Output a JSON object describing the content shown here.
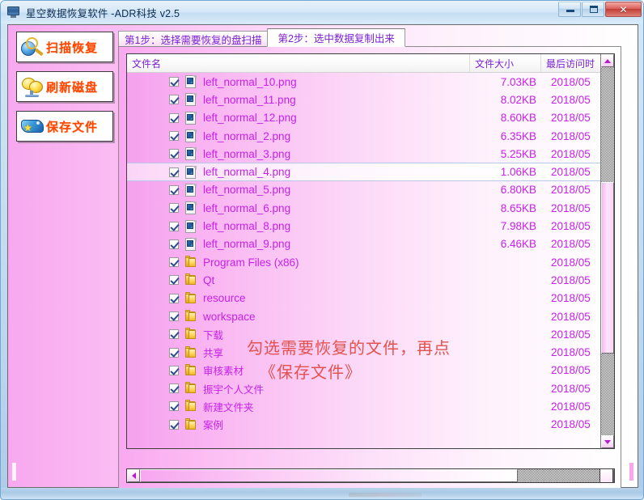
{
  "window": {
    "title": "星空数据恢复软件  -ADR科技 v2.5",
    "icon": "monitor-icon",
    "controls": {
      "minimize": "minimize-icon",
      "maximize": "maximize-icon",
      "close": "✕"
    }
  },
  "sidebar": {
    "buttons": [
      {
        "label": "扫描恢复",
        "icon": "magnifier-globe-icon"
      },
      {
        "label": "刷新磁盘",
        "icon": "refresh-disk-icon"
      },
      {
        "label": "保存文件",
        "icon": "save-file-icon"
      }
    ]
  },
  "tabs": [
    {
      "label": "第1步：选择需要恢复的盘扫描",
      "active": false
    },
    {
      "label": "第2步：选中数据复制出来",
      "active": true
    }
  ],
  "list": {
    "columns": [
      {
        "key": "name",
        "label": "文件名"
      },
      {
        "key": "size",
        "label": "文件大小"
      },
      {
        "key": "date",
        "label": "最后访问时"
      }
    ],
    "rows": [
      {
        "checked": true,
        "type": "file",
        "name": "left_normal_10.png",
        "size": "7.03KB",
        "date": "2018/05",
        "selected": false
      },
      {
        "checked": true,
        "type": "file",
        "name": "left_normal_11.png",
        "size": "8.02KB",
        "date": "2018/05",
        "selected": false
      },
      {
        "checked": true,
        "type": "file",
        "name": "left_normal_12.png",
        "size": "8.60KB",
        "date": "2018/05",
        "selected": false
      },
      {
        "checked": true,
        "type": "file",
        "name": "left_normal_2.png",
        "size": "6.35KB",
        "date": "2018/05",
        "selected": false
      },
      {
        "checked": true,
        "type": "file",
        "name": "left_normal_3.png",
        "size": "5.25KB",
        "date": "2018/05",
        "selected": false
      },
      {
        "checked": true,
        "type": "file",
        "name": "left_normal_4.png",
        "size": "1.06KB",
        "date": "2018/05",
        "selected": true
      },
      {
        "checked": true,
        "type": "file",
        "name": "left_normal_5.png",
        "size": "6.80KB",
        "date": "2018/05",
        "selected": false
      },
      {
        "checked": true,
        "type": "file",
        "name": "left_normal_6.png",
        "size": "8.65KB",
        "date": "2018/05",
        "selected": false
      },
      {
        "checked": true,
        "type": "file",
        "name": "left_normal_8.png",
        "size": "7.98KB",
        "date": "2018/05",
        "selected": false
      },
      {
        "checked": true,
        "type": "file",
        "name": "left_normal_9.png",
        "size": "6.46KB",
        "date": "2018/05",
        "selected": false
      },
      {
        "checked": true,
        "type": "folder",
        "name": "Program Files (x86)",
        "size": "",
        "date": "2018/05",
        "selected": false
      },
      {
        "checked": true,
        "type": "folder",
        "name": "Qt",
        "size": "",
        "date": "2018/05",
        "selected": false
      },
      {
        "checked": true,
        "type": "folder",
        "name": "resource",
        "size": "",
        "date": "2018/05",
        "selected": false
      },
      {
        "checked": true,
        "type": "folder",
        "name": "workspace",
        "size": "",
        "date": "2018/05",
        "selected": false
      },
      {
        "checked": true,
        "type": "folder",
        "name": "下载",
        "size": "",
        "date": "2018/05",
        "selected": false
      },
      {
        "checked": true,
        "type": "folder",
        "name": "共享",
        "size": "",
        "date": "2018/05",
        "selected": false
      },
      {
        "checked": true,
        "type": "folder",
        "name": "审核素材",
        "size": "",
        "date": "2018/05",
        "selected": false
      },
      {
        "checked": true,
        "type": "folder",
        "name": "振宇个人文件",
        "size": "",
        "date": "2018/05",
        "selected": false
      },
      {
        "checked": true,
        "type": "folder",
        "name": "新建文件夹",
        "size": "",
        "date": "2018/05",
        "selected": false
      },
      {
        "checked": true,
        "type": "folder",
        "name": "案例",
        "size": "",
        "date": "2018/05",
        "selected": false
      }
    ]
  },
  "annotation": {
    "line1": "勾选需要恢复的文件，再点",
    "line2": "《保存文件》",
    "color": "#e2524f"
  },
  "scrollbars": {
    "vertical": {
      "up": "triangle-up-icon",
      "down": "triangle-down-icon"
    },
    "horizontal": {
      "left": "triangle-left-icon",
      "right": "triangle-right-icon"
    }
  },
  "colors": {
    "accent_pink": "#f7a6ef",
    "list_text": "#c721e8",
    "tab_text": "#7b1fd6",
    "button_text": "#ff4500",
    "annotation": "#e2524f"
  }
}
